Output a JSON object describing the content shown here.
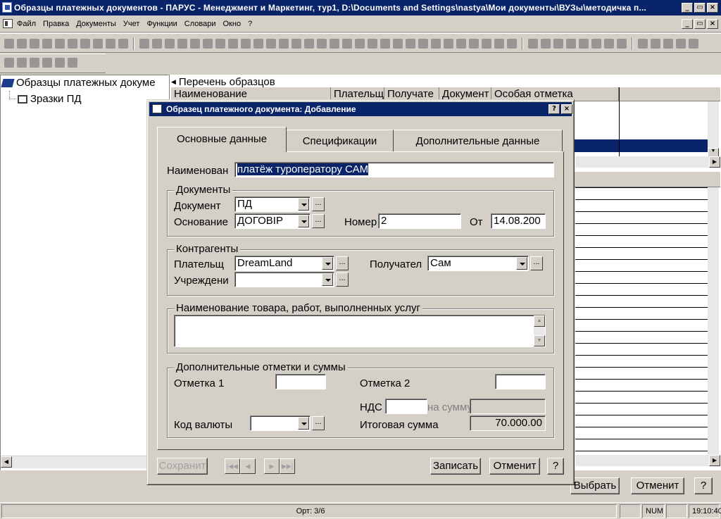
{
  "window": {
    "title": "Образцы платежных документов - ПАРУС - Менеджмент и Маркетинг, тур1, D:\\Documents and Settings\\nastya\\Мои документы\\ВУЗы\\методичка п..."
  },
  "menu": [
    "Файл",
    "Правка",
    "Документы",
    "Учет",
    "Функции",
    "Словари",
    "Окно",
    "?"
  ],
  "tree": {
    "root": "Образцы платежных докуме",
    "child": "Зразки ПД"
  },
  "list": {
    "title": "Перечень образцов",
    "columns": [
      "Наименование",
      "Плательщ",
      "Получате",
      "Документ",
      "Особая отметка"
    ]
  },
  "main_buttons": {
    "select": "Выбрать",
    "cancel": "Отменит",
    "help": "?"
  },
  "status": {
    "pane1": "Орт: 3/6",
    "num": "NUM",
    "time": "19:10:40"
  },
  "dialog": {
    "title": "Образец платежного документа: Добавление",
    "tabs": [
      "Основные данные",
      "Спецификации",
      "Дополнительные данные"
    ],
    "name_label": "Наименован",
    "name_value": "платёж туроператору САМ",
    "docs_group": "Документы",
    "doc_label": "Документ",
    "doc_value": "ПД",
    "basis_label": "Основание",
    "basis_value": "ДОГОВІР",
    "number_label": "Номер",
    "number_value": "2",
    "from_label": "От",
    "from_value": "14.08.200",
    "contr_group": "Контрагенты",
    "payer_label": "Плательщ",
    "payer_value": "DreamLand",
    "recipient_label": "Получател",
    "recipient_value": "Сам",
    "inst_label": "Учреждени",
    "inst_value": "",
    "goods_group": "Наименование товара, работ, выполненных услуг",
    "extra_group": "Дополнительные отметки и суммы",
    "mark1_label": "Отметка 1",
    "mark2_label": "Отметка 2",
    "vat_label": "НДС",
    "vat_sum_label": "на сумму",
    "currency_label": "Код валюты",
    "total_label": "Итоговая сумма",
    "total_value": "70.000.00",
    "ellipsis": "...",
    "btn_save": "Сохранит",
    "btn_write": "Записать",
    "btn_cancel": "Отменит",
    "btn_help": "?"
  }
}
